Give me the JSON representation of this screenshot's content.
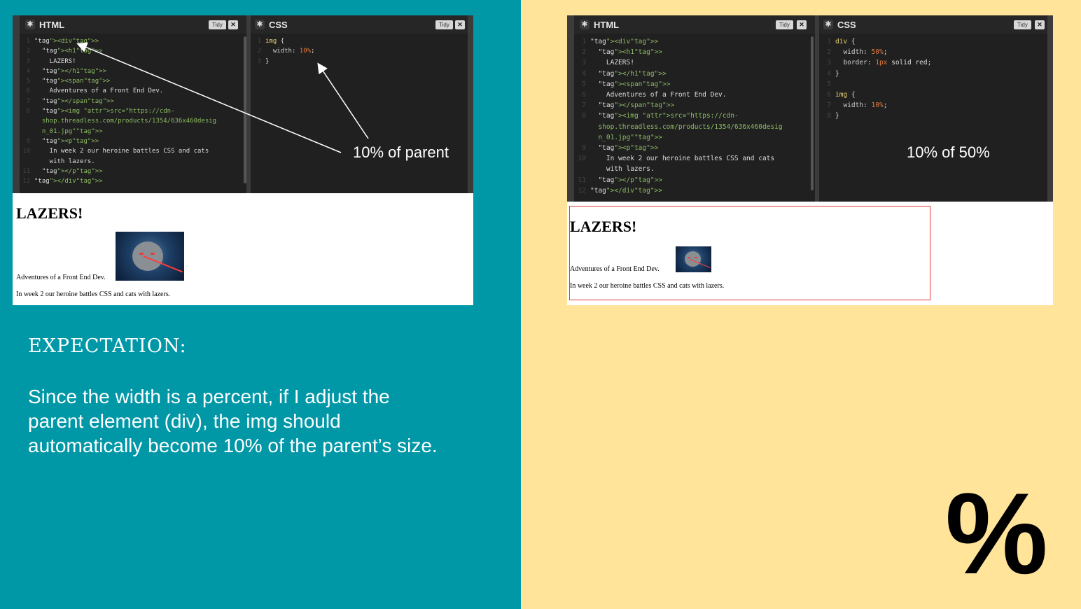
{
  "left_panel": {
    "html_pane": {
      "title": "HTML",
      "tidy_label": "Tidy",
      "close_label": "✕",
      "lines": [
        {
          "n": "1",
          "code": "<div>"
        },
        {
          "n": "2",
          "code": "  <h1>"
        },
        {
          "n": "3",
          "code": "    LAZERS!"
        },
        {
          "n": "4",
          "code": "  </h1>"
        },
        {
          "n": "5",
          "code": "  <span>"
        },
        {
          "n": "6",
          "code": "    Adventures of a Front End Dev."
        },
        {
          "n": "7",
          "code": "  </span>"
        },
        {
          "n": "8",
          "code": "  <img src=\"https://cdn-"
        },
        {
          "n": "",
          "code": "  shop.threadless.com/products/1354/636x460desig"
        },
        {
          "n": "",
          "code": "  n_01.jpg\">"
        },
        {
          "n": "9",
          "code": "  <p>"
        },
        {
          "n": "10",
          "code": "    In week 2 our heroine battles CSS and cats"
        },
        {
          "n": "",
          "code": "    with lazers."
        },
        {
          "n": "11",
          "code": "  </p>"
        },
        {
          "n": "12",
          "code": "</div>"
        }
      ]
    },
    "css_pane": {
      "title": "CSS",
      "tidy_label": "Tidy",
      "close_label": "✕",
      "lines": [
        {
          "n": "1",
          "code": "img {"
        },
        {
          "n": "2",
          "code": "  width: 10%;"
        },
        {
          "n": "3",
          "code": "}"
        }
      ]
    },
    "preview": {
      "heading": "LAZERS!",
      "span_text": "Adventures of a Front End Dev.",
      "paragraph": "In week 2 our heroine battles CSS and cats with lazers."
    },
    "callout": "10% of parent",
    "section_heading": "EXPECTATION:",
    "section_body": "Since the width is a percent, if I adjust the parent element (div), the img should automatically become 10% of the parent’s size.",
    "background_color": "#0097a7"
  },
  "right_panel": {
    "html_pane": {
      "title": "HTML",
      "tidy_label": "Tidy",
      "close_label": "✕",
      "lines": [
        {
          "n": "1",
          "code": "<div>"
        },
        {
          "n": "2",
          "code": "  <h1>"
        },
        {
          "n": "3",
          "code": "    LAZERS!"
        },
        {
          "n": "4",
          "code": "  </h1>"
        },
        {
          "n": "5",
          "code": "  <span>"
        },
        {
          "n": "6",
          "code": "    Adventures of a Front End Dev."
        },
        {
          "n": "7",
          "code": "  </span>"
        },
        {
          "n": "8",
          "code": "  <img src=\"https://cdn-"
        },
        {
          "n": "",
          "code": "  shop.threadless.com/products/1354/636x460desig"
        },
        {
          "n": "",
          "code": "  n_01.jpg\">"
        },
        {
          "n": "9",
          "code": "  <p>"
        },
        {
          "n": "10",
          "code": "    In week 2 our heroine battles CSS and cats"
        },
        {
          "n": "",
          "code": "    with lazers."
        },
        {
          "n": "11",
          "code": "  </p>"
        },
        {
          "n": "12",
          "code": "</div>"
        }
      ]
    },
    "css_pane": {
      "title": "CSS",
      "tidy_label": "Tidy",
      "close_label": "✕",
      "lines": [
        {
          "n": "1",
          "code": "div {"
        },
        {
          "n": "2",
          "code": "  width: 50%;"
        },
        {
          "n": "3",
          "code": "  border: 1px solid red;"
        },
        {
          "n": "4",
          "code": "}"
        },
        {
          "n": "5",
          "code": ""
        },
        {
          "n": "6",
          "code": "img {"
        },
        {
          "n": "7",
          "code": "  width: 10%;"
        },
        {
          "n": "8",
          "code": "}"
        }
      ]
    },
    "preview": {
      "heading": "LAZERS!",
      "span_text": "Adventures of a Front End Dev.",
      "paragraph": "In week 2 our heroine battles CSS and cats with lazers."
    },
    "callout": "10% of 50%",
    "symbol": "%",
    "background_color": "#ffe49a"
  }
}
